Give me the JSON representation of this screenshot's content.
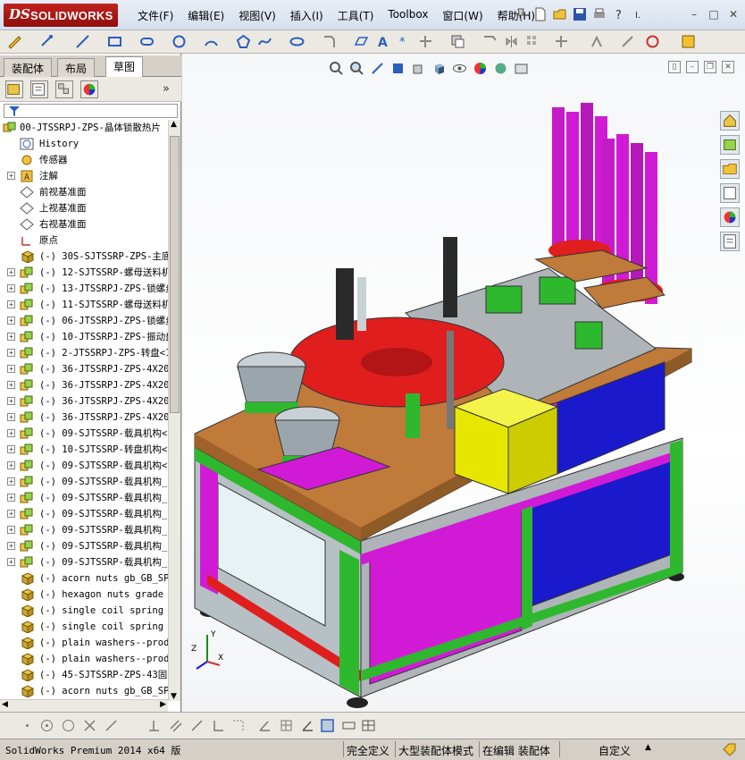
{
  "app": {
    "brand_ds": "DS",
    "brand_name": "SOLIDWORKS"
  },
  "menu": [
    "文件(F)",
    "编辑(E)",
    "视图(V)",
    "插入(I)",
    "工具(T)",
    "Toolbox",
    "窗口(W)",
    "帮助(H)"
  ],
  "window_controls": [
    "?",
    "–",
    "□",
    "✕"
  ],
  "left_tabs": [
    "装配体",
    "布局",
    "草图"
  ],
  "active_tab": "草图",
  "feature_tree": {
    "root": "00-JTSSRPJ-ZPS-晶体锁散热片",
    "items": [
      {
        "label": "History",
        "icon": "history-icon",
        "expand": false
      },
      {
        "label": "传感器",
        "icon": "sensor-icon",
        "expand": false
      },
      {
        "label": "注解",
        "icon": "annotation-icon",
        "expand": true
      },
      {
        "label": "前视基准面",
        "icon": "plane-icon",
        "expand": false
      },
      {
        "label": "上视基准面",
        "icon": "plane-icon",
        "expand": false
      },
      {
        "label": "右视基准面",
        "icon": "plane-icon",
        "expand": false
      },
      {
        "label": "原点",
        "icon": "origin-icon",
        "expand": false
      },
      {
        "label": "(-) 30S-SJTSSRP-ZPS-主底",
        "icon": "part-icon",
        "expand": false
      },
      {
        "label": "(-) 12-SJTSSRP-螺母送料机",
        "icon": "assembly-icon",
        "expand": true
      },
      {
        "label": "(-) 13-JTSSRPJ-ZPS-锁螺丝",
        "icon": "assembly-icon",
        "expand": true
      },
      {
        "label": "(-) 11-SJTSSRP-螺母送料机",
        "icon": "assembly-icon",
        "expand": true
      },
      {
        "label": "(-) 06-JTSSRPJ-ZPS-锁螺丝",
        "icon": "assembly-icon",
        "expand": true
      },
      {
        "label": "(-) 10-JTSSRPJ-ZPS-振动盘",
        "icon": "assembly-icon",
        "expand": true
      },
      {
        "label": "(-) 2-JTSSRPJ-ZPS-转盘<1",
        "icon": "assembly-icon",
        "expand": true
      },
      {
        "label": "(-) 36-JTSSRPJ-ZPS-4X20",
        "icon": "assembly-icon",
        "expand": true
      },
      {
        "label": "(-) 36-JTSSRPJ-ZPS-4X20",
        "icon": "assembly-icon",
        "expand": true
      },
      {
        "label": "(-) 36-JTSSRPJ-ZPS-4X20",
        "icon": "assembly-icon",
        "expand": true
      },
      {
        "label": "(-) 36-JTSSRPJ-ZPS-4X20",
        "icon": "assembly-icon",
        "expand": true
      },
      {
        "label": "(-) 09-SJTSSRP-载具机构<",
        "icon": "assembly-icon",
        "expand": true
      },
      {
        "label": "(-) 10-SJTSSRP-转盘机构<",
        "icon": "assembly-icon",
        "expand": true
      },
      {
        "label": "(-) 09-SJTSSRP-载具机构<",
        "icon": "assembly-icon",
        "expand": true
      },
      {
        "label": "(-) 09-SJTSSRP-载具机构_",
        "icon": "assembly-icon",
        "expand": true
      },
      {
        "label": "(-) 09-SJTSSRP-载具机构_",
        "icon": "assembly-icon",
        "expand": true
      },
      {
        "label": "(-) 09-SJTSSRP-载具机构_",
        "icon": "assembly-icon",
        "expand": true
      },
      {
        "label": "(-) 09-SJTSSRP-载具机构_",
        "icon": "assembly-icon",
        "expand": true
      },
      {
        "label": "(-) 09-SJTSSRP-载具机构_",
        "icon": "assembly-icon",
        "expand": true
      },
      {
        "label": "(-) 09-SJTSSRP-载具机构_",
        "icon": "assembly-icon",
        "expand": true
      },
      {
        "label": "(-) acorn nuts gb_GB_SPE",
        "icon": "part-icon",
        "expand": false
      },
      {
        "label": "(-) hexagon nuts grade c",
        "icon": "part-icon",
        "expand": false
      },
      {
        "label": "(-) single coil spring l",
        "icon": "part-icon",
        "expand": false
      },
      {
        "label": "(-) single coil spring l",
        "icon": "part-icon",
        "expand": false
      },
      {
        "label": "(-) plain washers--produ",
        "icon": "part-icon",
        "expand": false
      },
      {
        "label": "(-) plain washers--produ",
        "icon": "part-icon",
        "expand": false
      },
      {
        "label": "(-) 45-SJTSSRP-ZPS-43固",
        "icon": "part-icon",
        "expand": false
      },
      {
        "label": "(-) acorn nuts gb_GB_SPE",
        "icon": "part-icon",
        "expand": false
      }
    ]
  },
  "triad": {
    "z": "Z",
    "y": "Y",
    "x": "X"
  },
  "status": {
    "product": "SolidWorks Premium 2014 x64 版",
    "definition": "完全定义",
    "mode": "大型装配体模式",
    "editing": "在编辑 装配体",
    "units": "自定义"
  },
  "colors": {
    "base_orange": "#c07a3a",
    "frame_magenta": "#d11ad6",
    "frame_green": "#2eb82e",
    "door_blue": "#1a1acc",
    "box_yellow": "#e6e600",
    "table_red": "#e01e1e",
    "cabinet_gray": "#aeb4b8"
  }
}
